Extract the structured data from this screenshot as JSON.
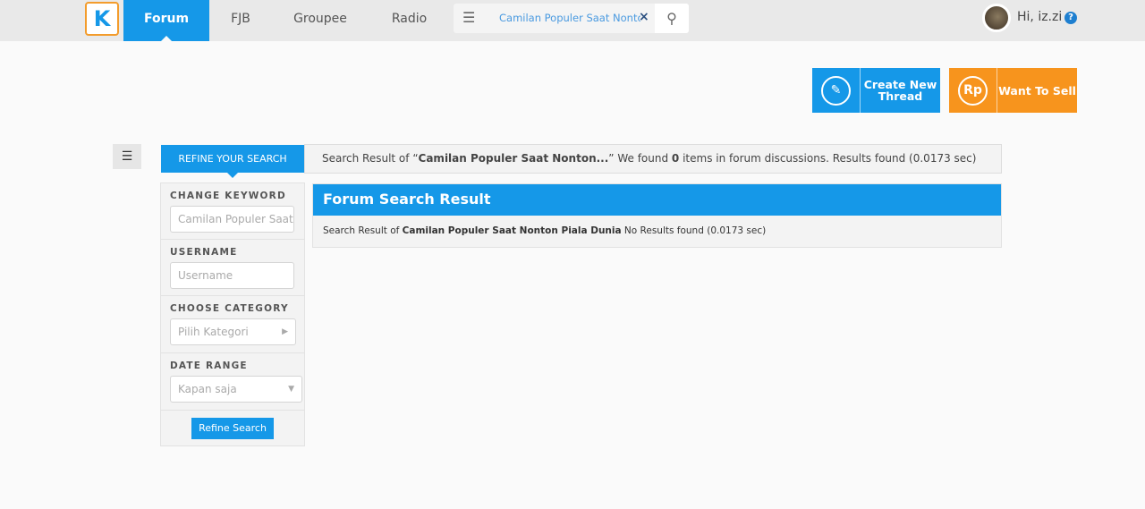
{
  "header": {
    "logo": "K",
    "nav": [
      "Forum",
      "FJB",
      "Groupee",
      "Radio"
    ],
    "search_value": "Camilan Populer Saat Nonton Piala Dunia",
    "greeting": "Hi, iz.zi",
    "help": "?"
  },
  "actions": {
    "create": "Create New Thread",
    "sell": "Want To Sell",
    "sell_icon": "Rp"
  },
  "refine": {
    "title": "REFINE YOUR SEARCH",
    "keyword_label": "CHANGE KEYWORD",
    "keyword_value": "Camilan Populer Saat Nonton Piala Dunia",
    "username_label": "USERNAME",
    "username_placeholder": "Username",
    "category_label": "CHOOSE CATEGORY",
    "category_value": "Pilih Kategori",
    "date_label": "DATE RANGE",
    "date_value": "Kapan saja",
    "button": "Refine Search"
  },
  "summary": {
    "prefix": "Search Result of “",
    "query": "Camilan Populer Saat Nonton...",
    "mid": "” We found ",
    "count": "0",
    "suffix": " items in forum discussions. Results found (0.0173 sec)"
  },
  "result": {
    "title": "Forum Search Result",
    "prefix": "Search Result of ",
    "query": "Camilan Populer Saat Nonton Piala Dunia",
    "suffix": " No Results found (0.0173 sec)"
  },
  "colors": {
    "primary": "#1598e8",
    "orange": "#f7941d"
  }
}
